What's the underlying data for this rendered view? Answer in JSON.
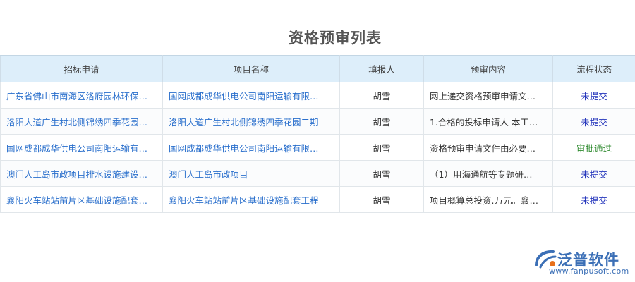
{
  "page": {
    "title": "资格预审列表"
  },
  "table": {
    "columns": [
      "招标申请",
      "项目名称",
      "填报人",
      "预审内容",
      "流程状态"
    ],
    "rows": [
      {
        "application": "广东省佛山市南海区洛府园林环保…",
        "project": "国网成都成华供电公司南阳运输有限…",
        "reporter": "胡雪",
        "content": "网上递交资格预审申请文…",
        "status": "未提交",
        "status_color": "#2233bb"
      },
      {
        "application": "洛阳大道广生村北侧锦绣四季花园…",
        "project": "洛阳大道广生村北侧锦绣四季花园二期",
        "reporter": "胡雪",
        "content": "1.合格的投标申请人 本工…",
        "status": "未提交",
        "status_color": "#2233bb"
      },
      {
        "application": "国网成都成华供电公司南阳运输有…",
        "project": "国网成都成华供电公司南阳运输有限…",
        "reporter": "胡雪",
        "content": "资格预审申请文件由必要…",
        "status": "审批通过",
        "status_color": "#2f8a2f"
      },
      {
        "application": "澳门人工岛市政项目排水设施建设…",
        "project": "澳门人工岛市政项目",
        "reporter": "胡雪",
        "content": "（1）用海通航等专题研…",
        "status": "未提交",
        "status_color": "#2233bb"
      },
      {
        "application": "襄阳火车站站前片区基础设施配套…",
        "project": "襄阳火车站站前片区基础设施配套工程",
        "reporter": "胡雪",
        "content": "项目概算总投资.万元。襄…",
        "status": "未提交",
        "status_color": "#2233bb"
      }
    ]
  },
  "logo": {
    "name": "泛普软件",
    "url": "www.fanpusoft.com",
    "brand_color": "#3b6fb6",
    "accent_color": "#e8701a"
  }
}
